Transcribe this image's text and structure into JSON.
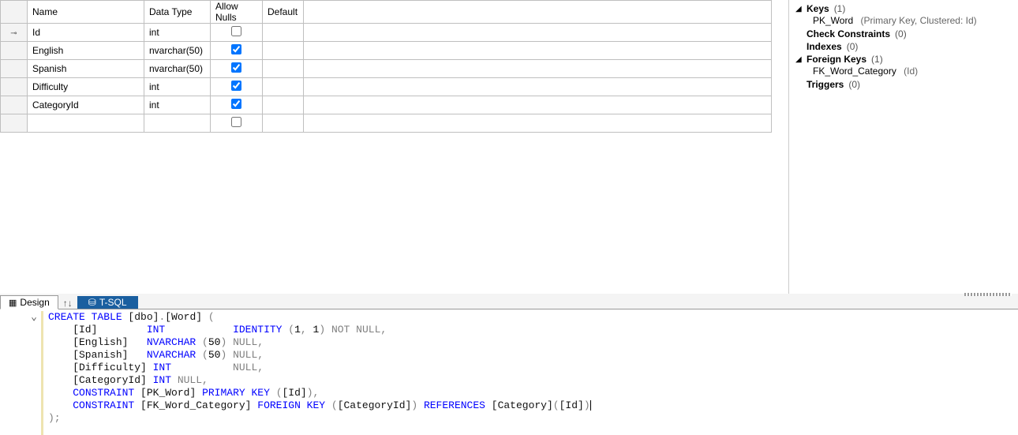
{
  "columns_header": {
    "name": "Name",
    "datatype": "Data Type",
    "allownulls": "Allow Nulls",
    "default": "Default"
  },
  "rows": [
    {
      "pk": true,
      "name": "Id",
      "datatype": "int",
      "nulls": false
    },
    {
      "pk": false,
      "name": "English",
      "datatype": "nvarchar(50)",
      "nulls": true
    },
    {
      "pk": false,
      "name": "Spanish",
      "datatype": "nvarchar(50)",
      "nulls": true
    },
    {
      "pk": false,
      "name": "Difficulty",
      "datatype": "int",
      "nulls": true
    },
    {
      "pk": false,
      "name": "CategoryId",
      "datatype": "int",
      "nulls": true
    }
  ],
  "side": {
    "keys": {
      "label": "Keys",
      "count": "(1)",
      "item": "PK_Word",
      "detail": "(Primary Key, Clustered: Id)"
    },
    "check": {
      "label": "Check Constraints",
      "count": "(0)"
    },
    "indexes": {
      "label": "Indexes",
      "count": "(0)"
    },
    "fks": {
      "label": "Foreign Keys",
      "count": "(1)",
      "item": "FK_Word_Category",
      "detail": "(Id)"
    },
    "triggers": {
      "label": "Triggers",
      "count": "(0)"
    }
  },
  "tabs": {
    "design": "Design",
    "tsql": "T-SQL",
    "updown": "↑↓"
  },
  "sql": {
    "l1a": "CREATE",
    "l1b": " TABLE",
    "l1c": " [dbo]",
    "l1d": ".",
    "l1e": "[Word]",
    "l1f": " (",
    "l2a": "    [Id]        ",
    "l2b": "INT",
    "l2c": "           ",
    "l2d": "IDENTITY",
    "l2e": " (",
    "l2f": "1",
    "l2g": ",",
    "l2h": " 1",
    "l2i": ")",
    "l2j": " NOT",
    "l2k": " NULL",
    "l2l": ",",
    "l3a": "    [English]   ",
    "l3b": "NVARCHAR",
    "l3c": " (",
    "l3d": "50",
    "l3e": ")",
    "l3f": " NULL",
    "l3g": ",",
    "l4a": "    [Spanish]   ",
    "l4b": "NVARCHAR",
    "l4c": " (",
    "l4d": "50",
    "l4e": ")",
    "l4f": " NULL",
    "l4g": ",",
    "l5a": "    [Difficulty] ",
    "l5b": "INT",
    "l5c": "          ",
    "l5d": "NULL",
    "l5e": ",",
    "l6a": "    [CategoryId] ",
    "l6b": "INT",
    "l6c": " NULL",
    "l6d": ",",
    "l7a": "    ",
    "l7b": "CONSTRAINT",
    "l7c": " [PK_Word] ",
    "l7d": "PRIMARY",
    "l7e": " KEY",
    "l7f": " (",
    "l7g": "[Id]",
    "l7h": ")",
    "l7i": ",",
    "l8a": "    ",
    "l8b": "CONSTRAINT",
    "l8c": " [FK_Word_Category] ",
    "l8d": "FOREIGN",
    "l8e": " KEY",
    "l8f": " (",
    "l8g": "[CategoryId]",
    "l8h": ")",
    "l8i": " REFERENCES",
    "l8j": " [Category]",
    "l8k": "(",
    "l8l": "[Id]",
    "l8m": ")",
    "l9a": ");"
  }
}
